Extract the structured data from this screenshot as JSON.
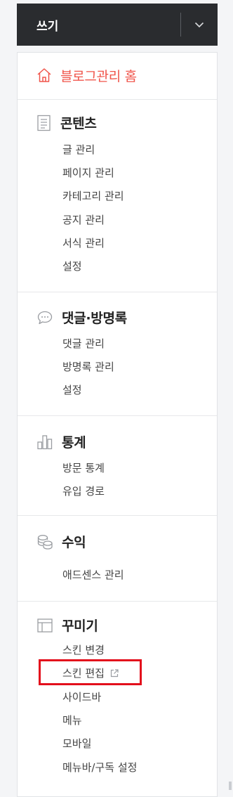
{
  "write": {
    "label": "쓰기"
  },
  "sidebar": {
    "home": {
      "label": "블로그관리 홈",
      "icon": "home-icon",
      "color": "#f0554b"
    },
    "sections": [
      {
        "title": "콘텐츠",
        "icon": "document-icon",
        "items": [
          "글 관리",
          "페이지 관리",
          "카테고리 관리",
          "공지 관리",
          "서식 관리",
          "설정"
        ]
      },
      {
        "title": "댓글·방명록",
        "icon": "speech-bubble-icon",
        "items": [
          "댓글 관리",
          "방명록 관리",
          "설정"
        ]
      },
      {
        "title": "통계",
        "icon": "bar-chart-icon",
        "items": [
          "방문 통계",
          "유입 경로"
        ]
      },
      {
        "title": "수익",
        "icon": "coins-icon",
        "items": [
          "애드센스 관리"
        ]
      },
      {
        "title": "꾸미기",
        "icon": "layout-icon",
        "items": [
          "스킨 변경",
          "스킨 편집",
          "사이드바",
          "메뉴",
          "모바일",
          "메뉴바/구독 설정"
        ],
        "external_item_index": 1
      }
    ]
  },
  "colors": {
    "write_bg": "#2a2c2f",
    "accent": "#f0554b",
    "highlight_border": "#e30f1c"
  }
}
